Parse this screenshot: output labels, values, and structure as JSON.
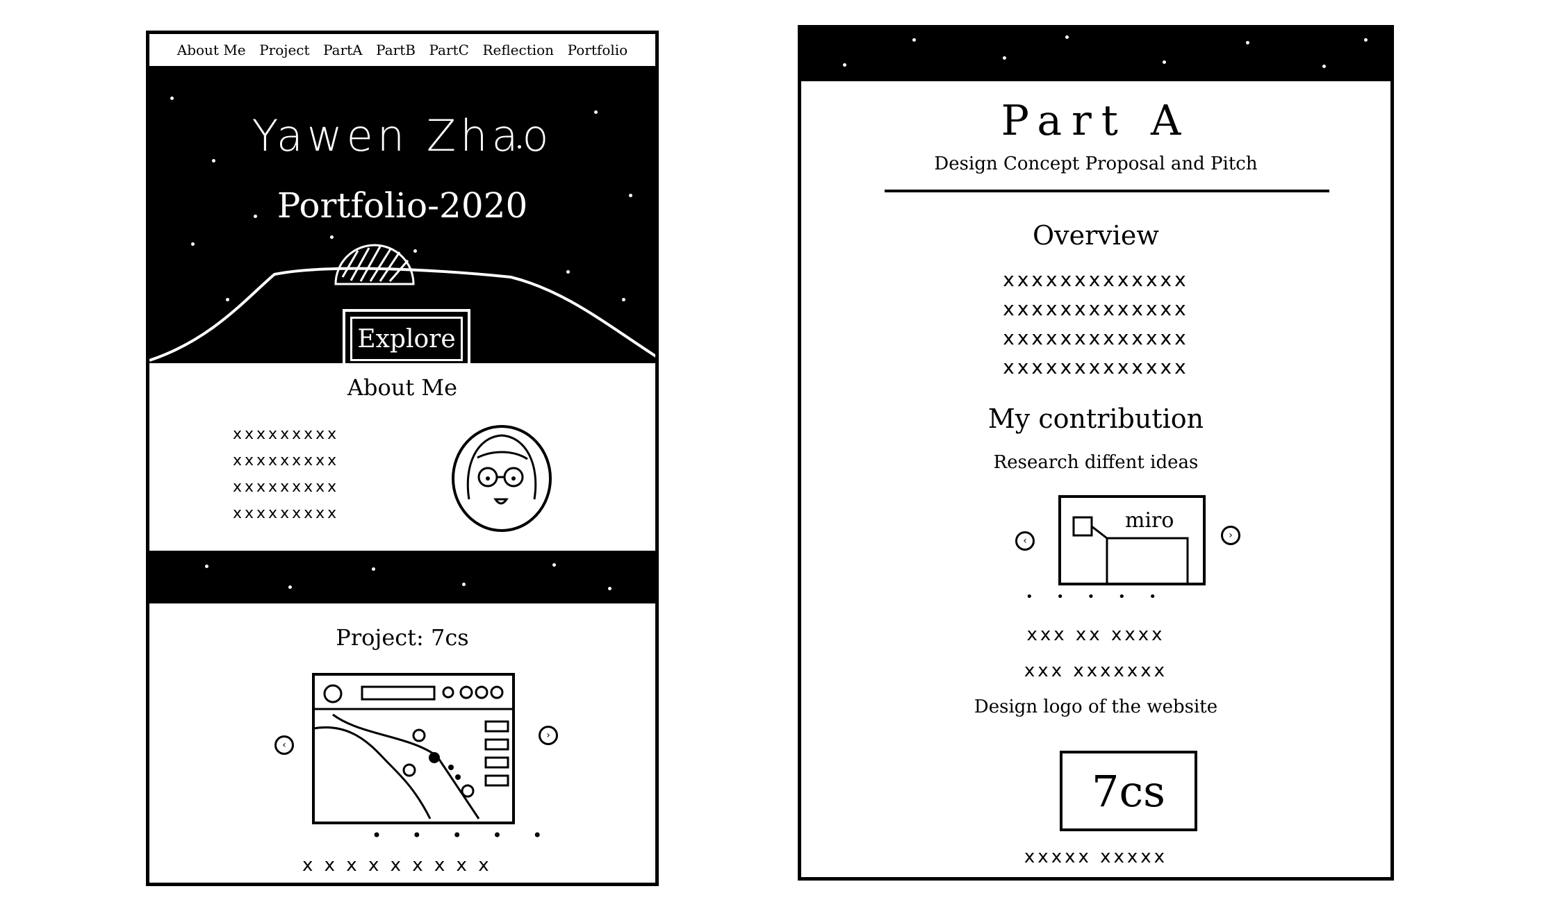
{
  "left_page": {
    "nav": [
      "About Me",
      "Project",
      "PartA",
      "PartB",
      "PartC",
      "Reflection",
      "Portfolio"
    ],
    "hero": {
      "name": "Yawen Zhao",
      "subtitle": "Portfolio-2020",
      "button": "Explore"
    },
    "about": {
      "title": "About Me",
      "text_rows": [
        "xxxxxxxxx",
        "xxxxxxxxx",
        "xxxxxxxxx",
        "xxxxxxxxx"
      ]
    },
    "project": {
      "title": "Project: 7cs",
      "dots": "• • • • •",
      "caption": "x x x  x x x  x x x"
    }
  },
  "right_page": {
    "title": "Part A",
    "subtitle": "Design Concept Proposal and Pitch",
    "overview": {
      "heading": "Overview",
      "rows": [
        "xxxxxxxxxxxxx",
        "xxxxxxxxxxxxx",
        "xxxxxxxxxxxxx",
        "xxxxxxxxxxxxx"
      ]
    },
    "contribution": {
      "heading": "My contribution",
      "item1": "Research diffent ideas",
      "miro_label": "miro",
      "dots": "• • • • •",
      "rows": [
        "xxx xx xxxx",
        "xxx xxxxxxx"
      ],
      "item2": "Design logo of the website",
      "logo_text": "7cs",
      "footer_row": "xxxxx xxxxx"
    }
  }
}
